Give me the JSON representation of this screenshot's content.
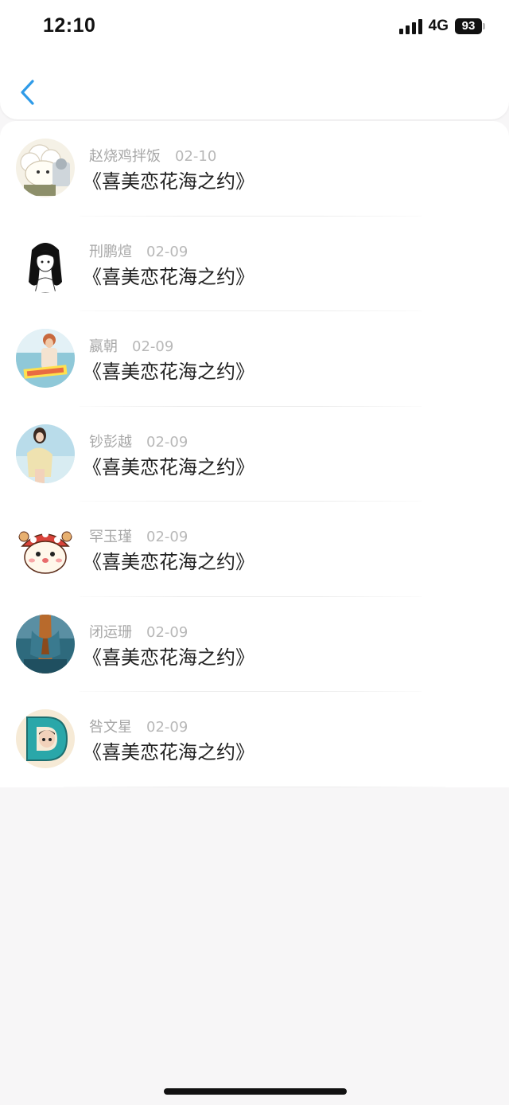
{
  "status_bar": {
    "time": "12:10",
    "network": "4G",
    "battery": "93"
  },
  "nav": {
    "back_icon": "chevron-left-icon",
    "accent_color": "#2f9be8"
  },
  "items": [
    {
      "name": "赵烧鸡拌饭",
      "date": "02-10",
      "title": "《喜美恋花海之约》",
      "avatar": "sheep-cartoon"
    },
    {
      "name": "刑鹏煊",
      "date": "02-09",
      "title": "《喜美恋花海之约》",
      "avatar": "girl-sketch"
    },
    {
      "name": "嬴朝",
      "date": "02-09",
      "title": "《喜美恋花海之约》",
      "avatar": "girl-street-photo"
    },
    {
      "name": "钞彭越",
      "date": "02-09",
      "title": "《喜美恋花海之约》",
      "avatar": "girl-beach-photo"
    },
    {
      "name": "罕玉瑾",
      "date": "02-09",
      "title": "《喜美恋花海之约》",
      "avatar": "hamster-cartoon"
    },
    {
      "name": "闭运珊",
      "date": "02-09",
      "title": "《喜美恋花海之约》",
      "avatar": "denim-photo"
    },
    {
      "name": "咎文星",
      "date": "02-09",
      "title": "《喜美恋花海之约》",
      "avatar": "letter-d-cartoon"
    }
  ]
}
